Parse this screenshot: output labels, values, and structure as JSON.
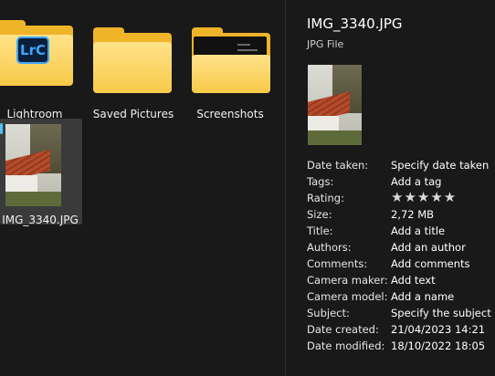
{
  "files": [
    {
      "name": "Lightroom",
      "type": "folder",
      "badge": "LrC"
    },
    {
      "name": "Saved Pictures",
      "type": "folder"
    },
    {
      "name": "Screenshots",
      "type": "folder"
    },
    {
      "name": "IMG_3340.JPG",
      "type": "image",
      "selected": true
    }
  ],
  "details": {
    "title": "IMG_3340.JPG",
    "file_type": "JPG File",
    "properties": [
      {
        "label": "Date taken:",
        "value": "Specify date taken"
      },
      {
        "label": "Tags:",
        "value": "Add a tag"
      },
      {
        "label": "Rating:",
        "value": "★★★★★",
        "rating": 0,
        "max": 5
      },
      {
        "label": "Size:",
        "value": "2,72 MB"
      },
      {
        "label": "Title:",
        "value": "Add a title"
      },
      {
        "label": "Authors:",
        "value": "Add an author"
      },
      {
        "label": "Comments:",
        "value": "Add comments"
      },
      {
        "label": "Camera maker:",
        "value": "Add text"
      },
      {
        "label": "Camera model:",
        "value": "Add a name"
      },
      {
        "label": "Subject:",
        "value": "Specify the subject"
      },
      {
        "label": "Date created:",
        "value": "21/04/2023 14:21"
      },
      {
        "label": "Date modified:",
        "value": "18/10/2022 18:05"
      }
    ]
  },
  "colors": {
    "accent": "#4cc2ff",
    "folder": "#f7c948",
    "background": "#191919"
  }
}
